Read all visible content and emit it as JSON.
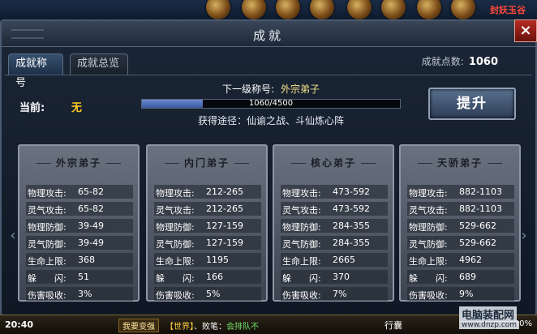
{
  "hud": {
    "area_tag": "封妖玉谷"
  },
  "dialog": {
    "title": "成就",
    "close_label": "×",
    "tabs": [
      {
        "label": "成就称号",
        "active": true
      },
      {
        "label": "成就总览",
        "active": false
      }
    ],
    "points_label": "成就点数:",
    "points_value": "1060",
    "current_label": "当前:",
    "current_value": "无",
    "next_label": "下一级称号:",
    "next_value": "外宗弟子",
    "progress_text": "1060/4500",
    "progress_fraction": 0.2356,
    "route": "获得途径：仙谕之战、斗仙炼心阵",
    "upgrade_label": "提升",
    "arrow_left": "‹",
    "arrow_right": "›"
  },
  "cards": [
    {
      "title": "外宗弟子",
      "stats": [
        {
          "label": "物理攻击:",
          "value": "65-82"
        },
        {
          "label": "灵气攻击:",
          "value": "65-82"
        },
        {
          "label": "物理防御:",
          "value": "39-49"
        },
        {
          "label": "灵气防御:",
          "value": "39-49"
        },
        {
          "label": "生命上限:",
          "value": "368"
        },
        {
          "label": "躲　　闪:",
          "value": "51"
        },
        {
          "label": "伤害吸收:",
          "value": "3%"
        }
      ]
    },
    {
      "title": "内门弟子",
      "stats": [
        {
          "label": "物理攻击:",
          "value": "212-265"
        },
        {
          "label": "灵气攻击:",
          "value": "212-265"
        },
        {
          "label": "物理防御:",
          "value": "127-159"
        },
        {
          "label": "灵气防御:",
          "value": "127-159"
        },
        {
          "label": "生命上限:",
          "value": "1195"
        },
        {
          "label": "躲　　闪:",
          "value": "166"
        },
        {
          "label": "伤害吸收:",
          "value": "5%"
        }
      ]
    },
    {
      "title": "核心弟子",
      "stats": [
        {
          "label": "物理攻击:",
          "value": "473-592"
        },
        {
          "label": "灵气攻击:",
          "value": "473-592"
        },
        {
          "label": "物理防御:",
          "value": "284-355"
        },
        {
          "label": "灵气防御:",
          "value": "284-355"
        },
        {
          "label": "生命上限:",
          "value": "2665"
        },
        {
          "label": "躲　　闪:",
          "value": "370"
        },
        {
          "label": "伤害吸收:",
          "value": "7%"
        }
      ]
    },
    {
      "title": "天骄弟子",
      "stats": [
        {
          "label": "物理攻击:",
          "value": "882-1103"
        },
        {
          "label": "灵气攻击:",
          "value": "882-1103"
        },
        {
          "label": "物理防御:",
          "value": "529-662"
        },
        {
          "label": "灵气防御:",
          "value": "529-662"
        },
        {
          "label": "生命上限:",
          "value": "4962"
        },
        {
          "label": "躲　　闪:",
          "value": "689"
        },
        {
          "label": "伤害吸收:",
          "value": "9%"
        }
      ]
    }
  ],
  "bottom": {
    "time": "20:40",
    "strengthen": "我要变强",
    "chat_channel": "【世界】",
    "chat_name": "、败笔：",
    "chat_message": "会排队不",
    "walk": "行囊",
    "zoom": "20%"
  },
  "watermark": {
    "main": "电脑装配网",
    "url": "www.dnzp.com"
  },
  "colors": {
    "accent_gold": "#ffcc22",
    "close_red": "#b42c22",
    "progress_blue": "#4a6ab8"
  }
}
